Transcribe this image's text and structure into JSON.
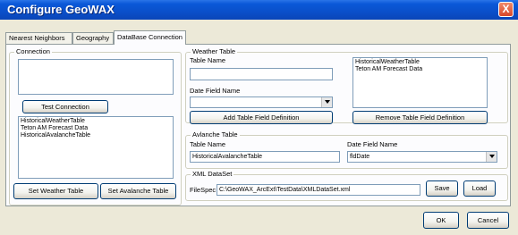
{
  "window": {
    "title": "Configure GeoWAX",
    "close_label": "X"
  },
  "tabs": [
    {
      "label": "Nearest Neighbors"
    },
    {
      "label": "Geography"
    },
    {
      "label": "DataBase Connection"
    }
  ],
  "connection": {
    "legend": "Connection",
    "connection_string": "",
    "test_button": "Test Connection",
    "tables": [
      "HistoricalWeatherTable",
      "Teton AM Forecast Data",
      "HistoricalAvalancheTable"
    ],
    "set_weather_button": "Set Weather Table",
    "set_avalanche_button": "Set Avalanche Table"
  },
  "weather_table": {
    "legend": "Weather Table",
    "table_name_label": "Table Name",
    "table_name_value": "",
    "date_field_label": "Date Field Name",
    "date_field_value": "",
    "add_button": "Add Table Field Definition",
    "remove_button": "Remove Table Field Definition",
    "tables": [
      "HistoricalWeatherTable",
      "Teton AM Forecast Data"
    ]
  },
  "avalanche_table": {
    "legend": "Avlanche Table",
    "table_name_label": "Table Name",
    "table_name_value": "HistoricalAvalancheTable",
    "date_field_label": "Date Field Name",
    "date_field_value": "fldDate"
  },
  "xml_dataset": {
    "legend": "XML DataSet",
    "filespec_label": "FileSpec",
    "filespec_value": "C:\\GeoWAX_ArcExt\\TestData\\XMLDataSet.xml",
    "save_button": "Save",
    "load_button": "Load"
  },
  "dialog": {
    "ok_button": "OK",
    "cancel_button": "Cancel"
  },
  "colors": {
    "titlebar": "#0a4fca",
    "dialog_face": "#ece9d8",
    "panel": "#fcfcfe",
    "close_button": "#d8482a"
  }
}
